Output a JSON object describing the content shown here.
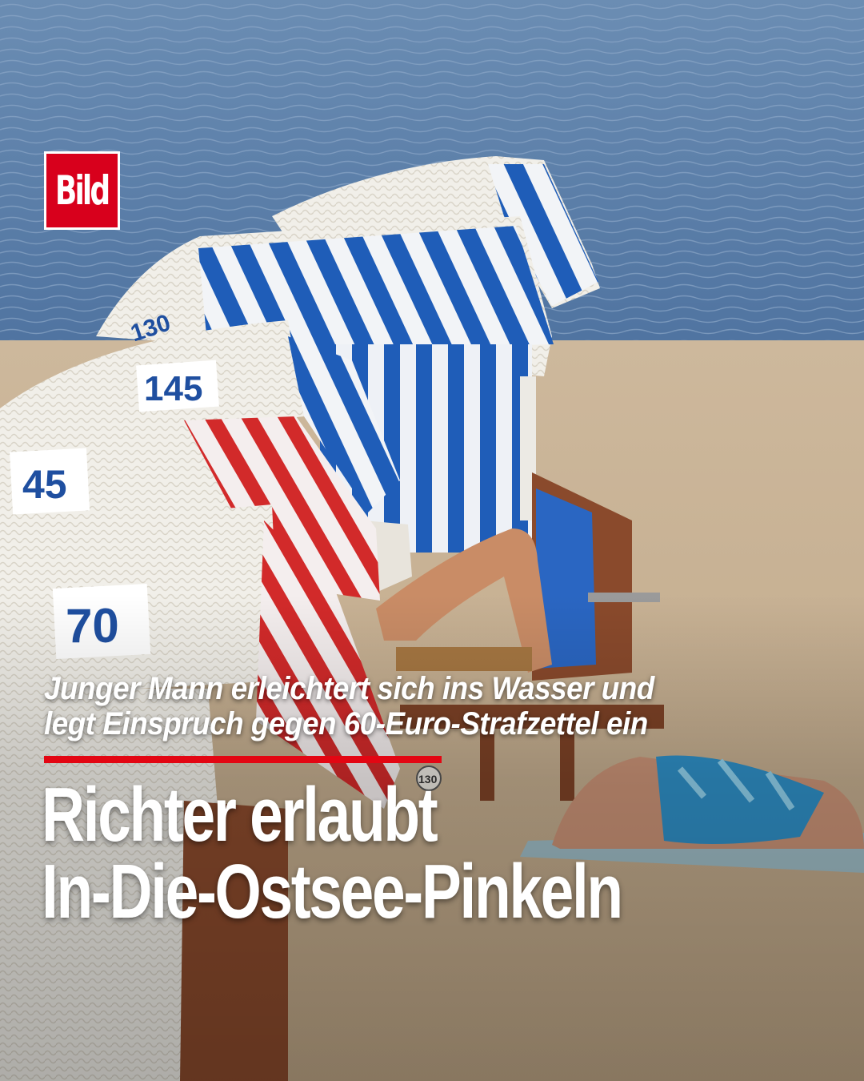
{
  "brand": {
    "logo_text": "Bild",
    "logo_color": "#d8001c"
  },
  "photo": {
    "description_icon": "beach-scene-image",
    "chair_numbers": [
      "130",
      "145",
      "45",
      "70",
      "130"
    ],
    "colors": {
      "sea": "#5a7fa6",
      "sand": "#c9b69c",
      "blue_stripe": "#1f5db8",
      "red_stripe": "#d22a2a"
    }
  },
  "article": {
    "kicker_lines": [
      "Junger Mann erleichtert sich ins Wasser und",
      "legt Einspruch gegen 60-Euro-Strafzettel ein"
    ],
    "headline_lines": [
      "Richter erlaubt",
      "In-Die-Ostsee-Pinkeln"
    ],
    "accent_color": "#e30613"
  }
}
